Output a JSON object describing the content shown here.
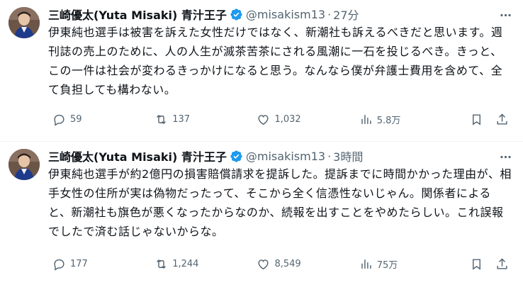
{
  "colors": {
    "text": "#0f1419",
    "muted": "#536471",
    "verified": "#1d9bf0",
    "divider": "#eff3f4"
  },
  "tweets": [
    {
      "display_name": "三崎優太(Yuta Misaki) 青汁王子",
      "handle": "@misakism13",
      "separator": "·",
      "time": "27分",
      "text": "伊東純也選手は被害を訴えた女性だけではなく、新潮社も訴えるべきだと思います。週刊誌の売上のために、人の人生が滅茶苦茶にされる風潮に一石を投じるべき。きっと、この一件は社会が変わるきっかけになると思う。なんなら僕が弁護士費用を含めて、全て負担しても構わない。",
      "replies": "59",
      "reposts": "137",
      "likes": "1,032",
      "views": "5.8万"
    },
    {
      "display_name": "三崎優太(Yuta Misaki) 青汁王子",
      "handle": "@misakism13",
      "separator": "·",
      "time": "3時間",
      "text": "伊東純也選手が約2億円の損害賠償請求を提訴した。提訴までに時間かかった理由が、相手女性の住所が実は偽物だったって、そこから全く信憑性ないじゃん。関係者によると、新潮社も旗色が悪くなったからなのか、続報を出すことをやめたらしい。これ誤報でしたで済む話じゃないからな。",
      "replies": "177",
      "reposts": "1,244",
      "likes": "8,549",
      "views": "75万"
    }
  ]
}
